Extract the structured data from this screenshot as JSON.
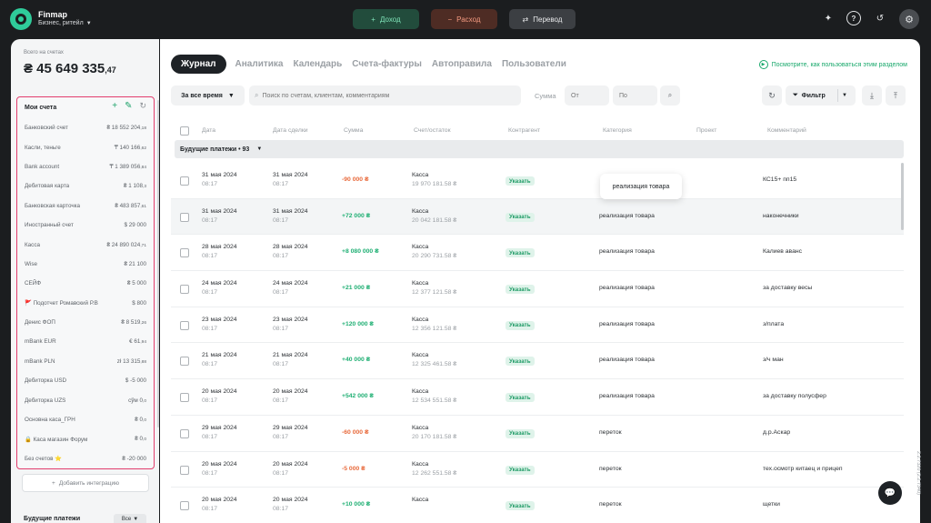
{
  "app": {
    "name": "Finmap",
    "workspace": "Бизнес, ритейл",
    "version": "2.2.7320 (2.2.7340)"
  },
  "topbar": {
    "income_label": "Доход",
    "expense_label": "Расход",
    "transfer_label": "Перевод"
  },
  "sidebar": {
    "total_label": "Всего на счетах",
    "total_value": "₴ 45 649 335",
    "total_cents": ",47",
    "accounts_title": "Мои счета",
    "accounts": [
      {
        "name": "Банковский счет",
        "amount": "₴ 18 552 204",
        "cents": ",18"
      },
      {
        "name": "Касли, теньге",
        "amount": "₸ 140 166",
        "cents": ",62"
      },
      {
        "name": "Bank account",
        "amount": "₸ 1 389 056",
        "cents": ",84"
      },
      {
        "name": "Дебитовая карта",
        "amount": "₴ 1 108",
        "cents": ",3"
      },
      {
        "name": "Банковская карточка",
        "amount": "₴ 483 857",
        "cents": ",61"
      },
      {
        "name": "Иностранный счет",
        "amount": "$ 29 000",
        "cents": ""
      },
      {
        "name": "Касса",
        "amount": "₴ 24 890 024",
        "cents": ",71"
      },
      {
        "name": "Wise",
        "amount": "₴ 21 100",
        "cents": ""
      },
      {
        "name": "СЕЙФ",
        "amount": "₴ 5 000",
        "cents": ""
      },
      {
        "name": "🚩 Подотчет Ромавский Р.В",
        "amount": "$ 800",
        "cents": ""
      },
      {
        "name": "Денис ФОП",
        "amount": "₴ 8 519",
        "cents": ",26"
      },
      {
        "name": "mBank EUR",
        "amount": "€ 61",
        "cents": ",94"
      },
      {
        "name": "mBank PLN",
        "amount": "zł 13 315",
        "cents": ",88"
      },
      {
        "name": "Дебиторка USD",
        "amount": "$ -5 000",
        "cents": ""
      },
      {
        "name": "Дебиторка UZS",
        "amount": "сўм 0",
        "cents": ",0"
      },
      {
        "name": "Основна каса_ГРН",
        "amount": "₴ 0",
        "cents": ",0"
      },
      {
        "name": "🔒 Каса магазин Форум",
        "amount": "₴ 0",
        "cents": ",0"
      },
      {
        "name": "Без счетов ⭐",
        "amount": "₴ -20 000",
        "cents": ""
      }
    ],
    "add_integration_label": "Добавить интеграцию",
    "future_label": "Будущие платежи",
    "future_filter": "Все"
  },
  "main": {
    "tabs": [
      "Журнал",
      "Аналитика",
      "Календарь",
      "Счета-фактуры",
      "Автоправила",
      "Пользователи"
    ],
    "howto_label": "Посмотрите, как пользоваться этим разделом",
    "period_label": "За все время",
    "search_placeholder": "Поиск по счетам, клиентам, комментариям",
    "sum_label": "Сумма",
    "sum_from_placeholder": "От",
    "sum_to_placeholder": "По",
    "filter_label": "Фильтр",
    "columns": [
      "Дата",
      "Дата сделки",
      "Сумма",
      "Счет/остаток",
      "Контрагент",
      "Категория",
      "Проект",
      "Комментарий"
    ],
    "group_label": "Будущие платежи • 93",
    "tooltip": "реализация товара",
    "specify_label": "Указать",
    "rows": [
      {
        "date": "31 мая 2024",
        "time": "08:17",
        "deal": "31 мая 2024",
        "deal_time": "08:17",
        "sum": "-90 000 ₴",
        "sign": "neg",
        "account": "Касса",
        "balance": "19 970 181.58 ₴",
        "category": "",
        "comment": "КС15+ пп15"
      },
      {
        "date": "31 мая 2024",
        "time": "08:17",
        "deal": "31 мая 2024",
        "deal_time": "08:17",
        "sum": "+72 000 ₴",
        "sign": "pos",
        "account": "Касса",
        "balance": "20 042 181.58 ₴",
        "category": "реализация товара",
        "comment": "наконечники"
      },
      {
        "date": "28 мая 2024",
        "time": "08:17",
        "deal": "28 мая 2024",
        "deal_time": "08:17",
        "sum": "+8 080 000 ₴",
        "sign": "pos",
        "account": "Касса",
        "balance": "20 290 731.58 ₴",
        "category": "реализация товара",
        "comment": "Калиев аванс"
      },
      {
        "date": "24 мая 2024",
        "time": "08:17",
        "deal": "24 мая 2024",
        "deal_time": "08:17",
        "sum": "+21 000 ₴",
        "sign": "pos",
        "account": "Касса",
        "balance": "12 377 121.58 ₴",
        "category": "реализация товара",
        "comment": "за доставку весы"
      },
      {
        "date": "23 мая 2024",
        "time": "08:17",
        "deal": "23 мая 2024",
        "deal_time": "08:17",
        "sum": "+120 000 ₴",
        "sign": "pos",
        "account": "Касса",
        "balance": "12 356 121.58 ₴",
        "category": "реализация товара",
        "comment": "з/плата"
      },
      {
        "date": "21 мая 2024",
        "time": "08:17",
        "deal": "21 мая 2024",
        "deal_time": "08:17",
        "sum": "+40 000 ₴",
        "sign": "pos",
        "account": "Касса",
        "balance": "12 325 461.58 ₴",
        "category": "реализация товара",
        "comment": "з/ч ман"
      },
      {
        "date": "20 мая 2024",
        "time": "08:17",
        "deal": "20 мая 2024",
        "deal_time": "08:17",
        "sum": "+542 000 ₴",
        "sign": "pos",
        "account": "Касса",
        "balance": "12 534 551.58 ₴",
        "category": "реализация товара",
        "comment": "за доставку полусфер"
      },
      {
        "date": "29 мая 2024",
        "time": "08:17",
        "deal": "29 мая 2024",
        "deal_time": "08:17",
        "sum": "-60 000 ₴",
        "sign": "neg",
        "account": "Касса",
        "balance": "20 170 181.58 ₴",
        "category": "переток",
        "comment": "д.р.Аскар"
      },
      {
        "date": "20 мая 2024",
        "time": "08:17",
        "deal": "20 мая 2024",
        "deal_time": "08:17",
        "sum": "-5 000 ₴",
        "sign": "neg",
        "account": "Касса",
        "balance": "12 262 551.58 ₴",
        "category": "переток",
        "comment": "тех.осмотр китаец и прицеп"
      },
      {
        "date": "20 мая 2024",
        "time": "08:17",
        "deal": "20 мая 2024",
        "deal_time": "08:17",
        "sum": "+10 000 ₴",
        "sign": "pos",
        "account": "Касса",
        "balance": "",
        "category": "переток",
        "comment": "щетки"
      }
    ]
  },
  "colors": {
    "brand": "#2fcb9a",
    "income": "#1faf73",
    "expense": "#e86a3c",
    "highlight_border": "#e23d6d"
  }
}
